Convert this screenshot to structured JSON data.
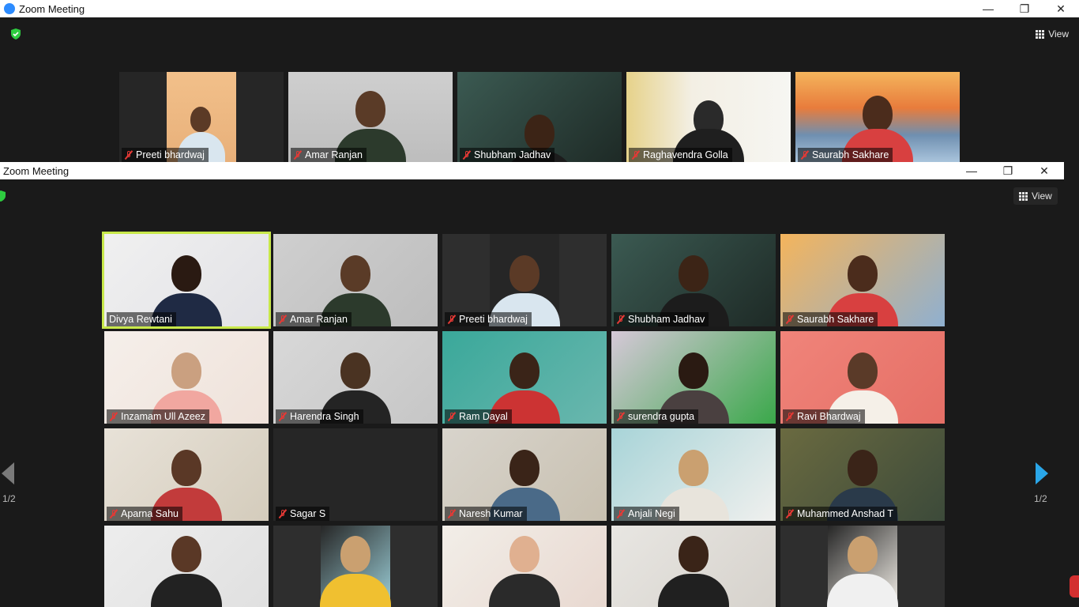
{
  "back_window": {
    "title": "Zoom Meeting",
    "view_label": "View",
    "tiles": [
      {
        "name": "Preeti bhardwaj"
      },
      {
        "name": "Amar Ranjan"
      },
      {
        "name": "Shubham Jadhav"
      },
      {
        "name": "Raghavendra Golla"
      },
      {
        "name": "Saurabh Sakhare"
      }
    ]
  },
  "front_window": {
    "title": "Zoom Meeting",
    "view_label": "View",
    "page_left": "1/2",
    "page_right": "1/2",
    "rows": [
      [
        {
          "name": "Divya Rewtani",
          "muted": false,
          "active": true
        },
        {
          "name": "Amar Ranjan",
          "muted": true
        },
        {
          "name": "Preeti bhardwaj",
          "muted": true
        },
        {
          "name": "Shubham Jadhav",
          "muted": true
        },
        {
          "name": "Saurabh Sakhare",
          "muted": true
        }
      ],
      [
        {
          "name": "Inzamam Ull Azeez",
          "muted": true
        },
        {
          "name": "Harendra Singh",
          "muted": true
        },
        {
          "name": "Ram Dayal",
          "muted": true
        },
        {
          "name": "surendra gupta",
          "muted": true
        },
        {
          "name": "Ravi Bhardwaj",
          "muted": true
        }
      ],
      [
        {
          "name": "Aparna Sahu",
          "muted": true
        },
        {
          "name": "Sagar S",
          "muted": true
        },
        {
          "name": "Naresh Kumar",
          "muted": true
        },
        {
          "name": "Anjali Negi",
          "muted": true
        },
        {
          "name": "Muhammed Anshad T",
          "muted": true
        }
      ],
      [
        {
          "name": "",
          "muted": false
        },
        {
          "name": "",
          "muted": false
        },
        {
          "name": "",
          "muted": false
        },
        {
          "name": "",
          "muted": false
        },
        {
          "name": "",
          "muted": false
        }
      ]
    ]
  },
  "colors": {
    "active_speaker": "#c8e84a",
    "shield": "#2ecc40",
    "nav_arrow": "#2aa6e8",
    "mute": "#e53935"
  }
}
